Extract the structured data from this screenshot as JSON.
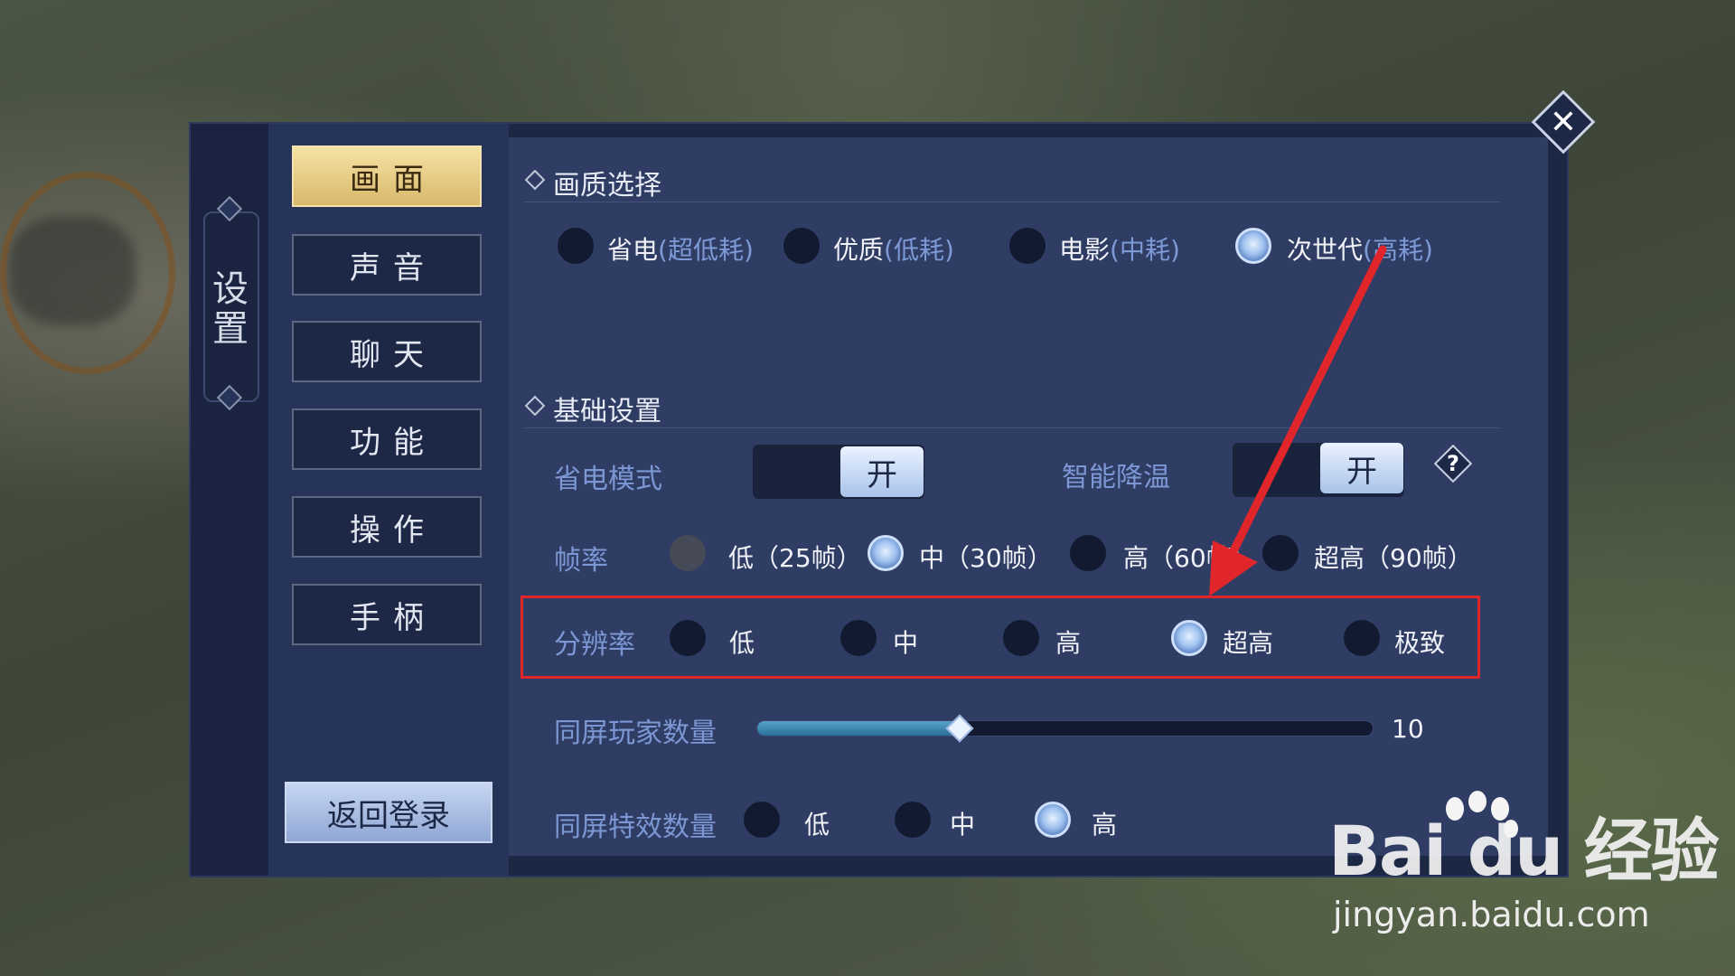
{
  "settings_title": "设置",
  "tabs": [
    {
      "label": "画面",
      "active": true
    },
    {
      "label": "声音",
      "active": false
    },
    {
      "label": "聊天",
      "active": false
    },
    {
      "label": "功能",
      "active": false
    },
    {
      "label": "操作",
      "active": false
    },
    {
      "label": "手柄",
      "active": false
    }
  ],
  "back_button": "返回登录",
  "quality": {
    "title": "画质选择",
    "options": [
      {
        "name": "省电",
        "hint": "(超低耗)",
        "selected": false
      },
      {
        "name": "优质",
        "hint": "(低耗)",
        "selected": false
      },
      {
        "name": "电影",
        "hint": "(中耗)",
        "selected": false
      },
      {
        "name": "次世代",
        "hint": "(高耗)",
        "selected": true
      }
    ]
  },
  "basic": {
    "title": "基础设置",
    "power_saving": {
      "label": "省电模式",
      "state": "开"
    },
    "smart_cooling": {
      "label": "智能降温",
      "state": "开"
    },
    "help_icon": "?",
    "framerate": {
      "label": "帧率",
      "options": [
        {
          "text": "低（25帧）",
          "selected": false
        },
        {
          "text": "中（30帧）",
          "selected": true
        },
        {
          "text": "高（60帧）",
          "selected": false
        },
        {
          "text": "超高（90帧）",
          "selected": false
        }
      ]
    },
    "resolution": {
      "label": "分辨率",
      "options": [
        {
          "text": "低",
          "selected": false
        },
        {
          "text": "中",
          "selected": false
        },
        {
          "text": "高",
          "selected": false
        },
        {
          "text": "超高",
          "selected": true
        },
        {
          "text": "极致",
          "selected": false
        }
      ]
    },
    "players_on_screen": {
      "label": "同屏玩家数量",
      "value": "10",
      "level": 0.33
    },
    "effects_on_screen": {
      "label": "同屏特效数量",
      "options": [
        {
          "text": "低",
          "selected": false
        },
        {
          "text": "中",
          "selected": false
        },
        {
          "text": "高",
          "selected": true
        }
      ]
    }
  },
  "close_icon": "✕",
  "watermark": {
    "logo": "Bai du 经验",
    "url": "jingyan.baidu.com"
  },
  "colors": {
    "accent": "#d9b86a",
    "annotation": "#e0262b",
    "panel": "#1c2743"
  }
}
